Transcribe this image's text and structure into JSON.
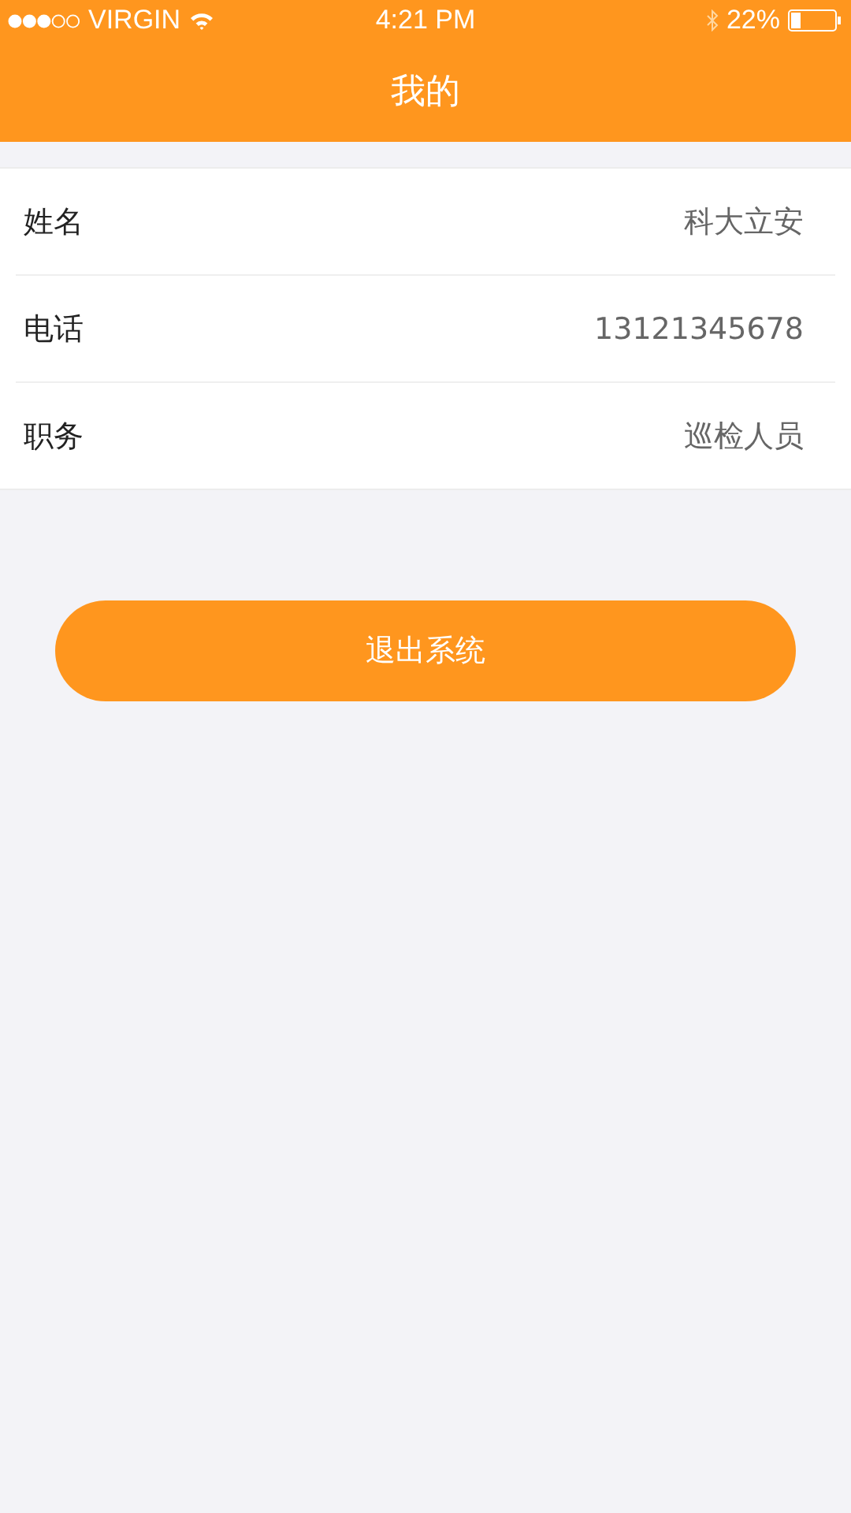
{
  "status_bar": {
    "carrier": "VIRGIN",
    "time": "4:21 PM",
    "battery": "22%"
  },
  "header": {
    "title": "我的"
  },
  "rows": [
    {
      "label": "姓名",
      "value": "科大立安"
    },
    {
      "label": "电话",
      "value": "13121345678"
    },
    {
      "label": "职务",
      "value": "巡检人员"
    }
  ],
  "logout_button": "退出系统"
}
